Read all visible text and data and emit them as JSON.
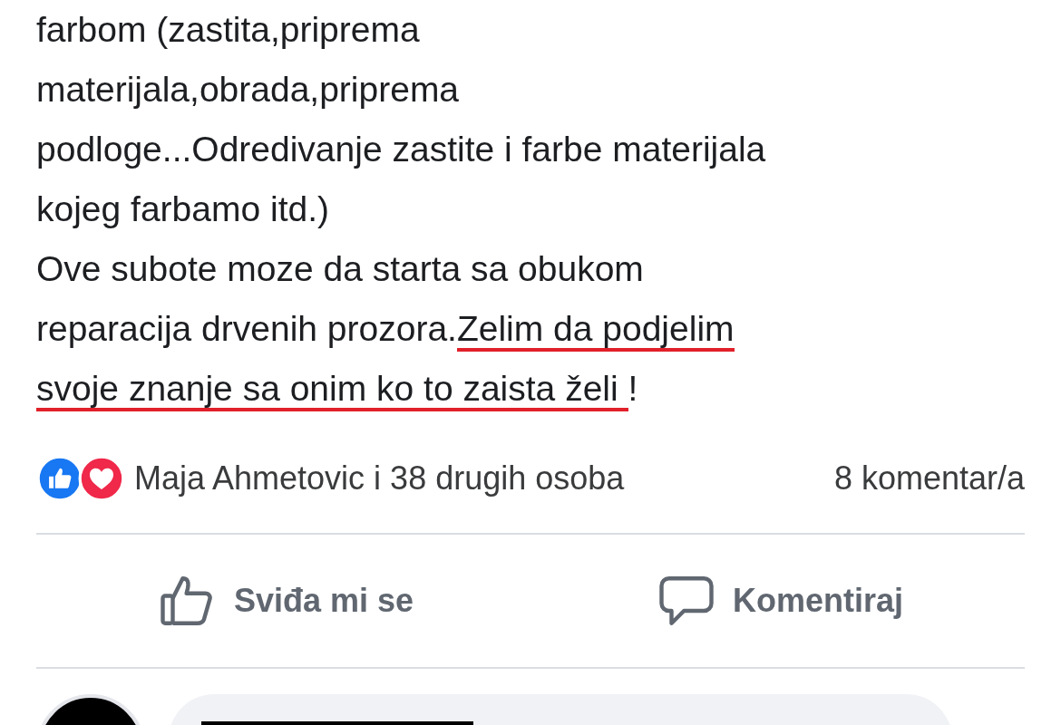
{
  "post": {
    "lines": [
      [
        {
          "text": "farbom (zastita,priprema",
          "underlined": false
        }
      ],
      [
        {
          "text": "materijala,obrada,priprema",
          "underlined": false
        }
      ],
      [
        {
          "text": "podloge...Odredivanje zastite i farbe materijala",
          "underlined": false
        }
      ],
      [
        {
          "text": "kojeg farbamo itd.)",
          "underlined": false
        }
      ],
      [
        {
          "text": "Ove subote moze da starta sa obukom",
          "underlined": false
        }
      ],
      [
        {
          "text": "reparacija drvenih prozora.",
          "underlined": false
        },
        {
          "text": "Zelim da podjelim",
          "underlined": true
        }
      ],
      [
        {
          "text": "svoje znanje sa onim ko to zaista želi ",
          "underlined": true
        },
        {
          "text": "!",
          "underlined": false
        }
      ]
    ]
  },
  "reactions": {
    "summary": "Maja Ahmetovic i 38 drugih osoba",
    "comments": "8 komentar/a"
  },
  "actions": [
    {
      "kind": "like",
      "label": "Sviđa mi se"
    },
    {
      "kind": "comment",
      "label": "Komentiraj"
    }
  ]
}
